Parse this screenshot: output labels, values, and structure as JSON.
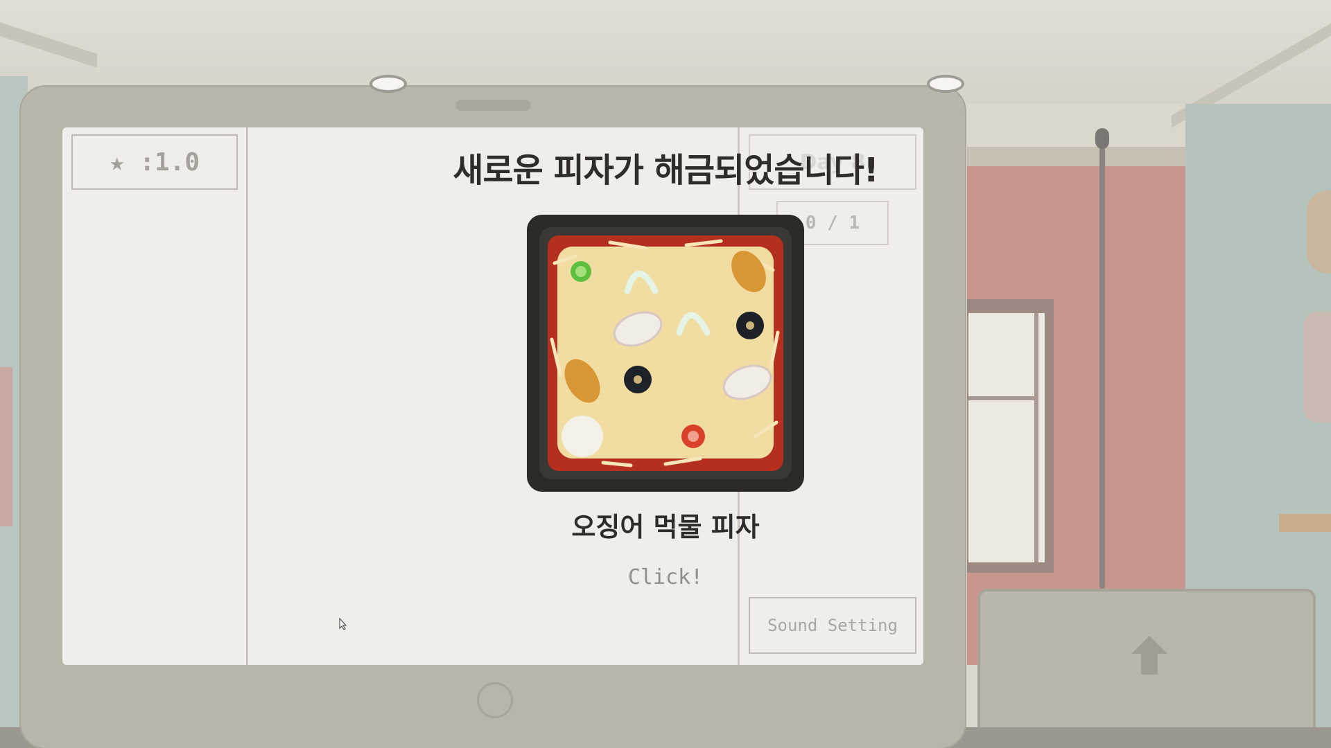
{
  "hud": {
    "rating_label": "★ :1.0",
    "day_label": "Day 8",
    "progress_label": "0 / 1"
  },
  "unlock_popup": {
    "title": "새로운 피자가 해금되었습니다!",
    "pizza_name": "오징어 먹물 피자",
    "prompt": "Click!"
  },
  "menu": {
    "sound_setting_label": "Sound Setting"
  },
  "colors": {
    "screen_bg": "#efeeea",
    "tablet_frame": "#b9b5aa",
    "title_text": "#2f2d2b",
    "wall_red": "#c9968f",
    "wall_teal": "#b4c4bd",
    "pizza_pan": "#2b2a27",
    "pizza_cheese": "#f1dda2",
    "pizza_sauce": "#b42f1f"
  },
  "icons": {
    "rating": "star-icon",
    "pizza": "squid-ink-pizza-image",
    "cursor": "mouse-pointer-icon",
    "counter": "up-arrow-icon"
  }
}
